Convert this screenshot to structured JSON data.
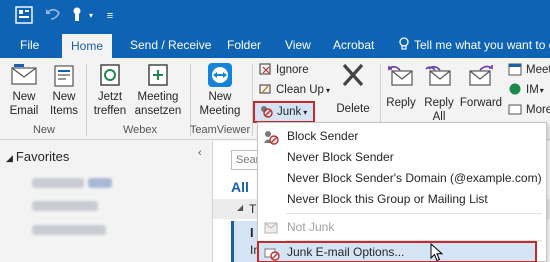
{
  "quick_access": {
    "icons": [
      "outlook-app-icon",
      "undo-icon",
      "send-receive-icon",
      "customize-icon"
    ]
  },
  "tabs": [
    {
      "label": "File"
    },
    {
      "label": "Home"
    },
    {
      "label": "Send / Receive"
    },
    {
      "label": "Folder"
    },
    {
      "label": "View"
    },
    {
      "label": "Acrobat"
    },
    {
      "label": "Tell me what you want to do"
    }
  ],
  "ribbon": {
    "new_email": "New\nEmail",
    "new_items": "New\nItems",
    "group_new": "New",
    "jetzt_treffen": "Jetzt\ntreffen",
    "meeting_ansetzen": "Meeting\nansetzen",
    "group_webex": "Webex",
    "new_meeting": "New\nMeeting",
    "group_teamviewer": "TeamViewer",
    "ignore": "Ignore",
    "clean_up": "Clean Up",
    "junk": "Junk",
    "delete": "Delete",
    "reply": "Reply",
    "reply_all": "Reply\nAll",
    "forward": "Forward",
    "meeting_small": "Meet",
    "im_small": "IM",
    "more_small": "More"
  },
  "nav": {
    "favorites": "Favorites"
  },
  "list": {
    "search_placeholder": "Sear",
    "all_label": "All",
    "t_label": "T",
    "i_label": "I",
    "in_label": "In"
  },
  "junk_menu": {
    "items": [
      {
        "label": "Block Sender",
        "disabled": false
      },
      {
        "label": "Never Block Sender",
        "disabled": false
      },
      {
        "label": "Never Block Sender's Domain (@example.com)",
        "disabled": false
      },
      {
        "label": "Never Block this Group or Mailing List",
        "disabled": false
      },
      {
        "label": "Not Junk",
        "disabled": true
      },
      {
        "label": "Junk E-mail Options...",
        "disabled": false
      }
    ]
  },
  "colors": {
    "titlebar": "#0f63b5",
    "highlight_border": "#c42b2b",
    "accent": "#1b5fa8"
  }
}
